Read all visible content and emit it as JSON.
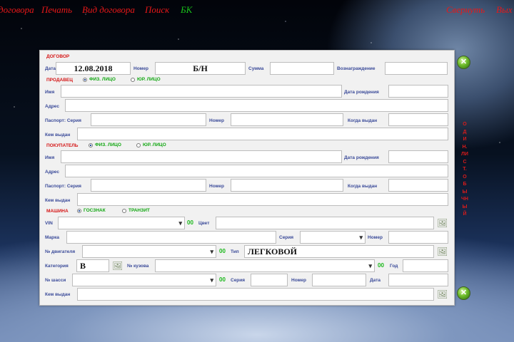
{
  "menu": {
    "dogovora": "договора",
    "print": "Печать",
    "view": "Вид договора",
    "search": "Поиск",
    "bk": "БК",
    "collapse": "Свернуть",
    "exit": "Вых"
  },
  "contract": {
    "section": "ДОГОВОР",
    "date_label": "Дата",
    "date_value": "12.08.2018",
    "number_label": "Номер",
    "number_value": "Б/Н",
    "sum_label": "Сумма",
    "reward_label": "Вознаграждение"
  },
  "seller": {
    "section": "ПРОДАВЕЦ",
    "radio_phys": "ФИЗ. ЛИЦО",
    "radio_jur": "ЮР. ЛИЦО",
    "name_label": "Имя",
    "birth_label": "Дата рождения",
    "address_label": "Адрес",
    "passport_label": "Паспорт:  Серия",
    "pnumber_label": "Номер",
    "issued_when_label": "Когда выдан",
    "issued_by_label": "Кем выдан"
  },
  "buyer": {
    "section": "ПОКУПАТЕЛЬ",
    "radio_phys": "ФИЗ. ЛИЦО",
    "radio_jur": "ЮР. ЛИЦО",
    "name_label": "Имя",
    "birth_label": "Дата рождения",
    "address_label": "Адрес",
    "passport_label": "Паспорт:  Серия",
    "pnumber_label": "Номер",
    "issued_when_label": "Когда выдан",
    "issued_by_label": "Кем выдан"
  },
  "car": {
    "section": "МАШИНА",
    "radio_gos": "ГОСЗНАК",
    "radio_tranzit": "ТРАНЗИТ",
    "vin_label": "VIN",
    "oo": "00",
    "color_label": "Цвет",
    "brand_label": "Марка",
    "series_label": "Серия",
    "number_label": "Номер",
    "engine_label": "№ двигателя",
    "type_label": "Тип",
    "type_value": "ЛЕГКОВОЙ",
    "category_label": "Категория",
    "category_value": "B",
    "body_label": "№ кузова",
    "year_label": "Год",
    "chassis_label": "№ шасси",
    "ser_label": "Серия",
    "pts_number_label": "Номер",
    "date_label": "Дата",
    "issued_by_label": "Кем выдан"
  },
  "side": {
    "vertical_text": "ОДИН.ЛИСТ.ОБЫЧНЫЙ"
  },
  "icons": {
    "go": "xbox-icon",
    "picture": "picture-icon"
  },
  "colors": {
    "label": "#3a4a99",
    "section": "#d51616",
    "accent_green": "#12a712"
  }
}
